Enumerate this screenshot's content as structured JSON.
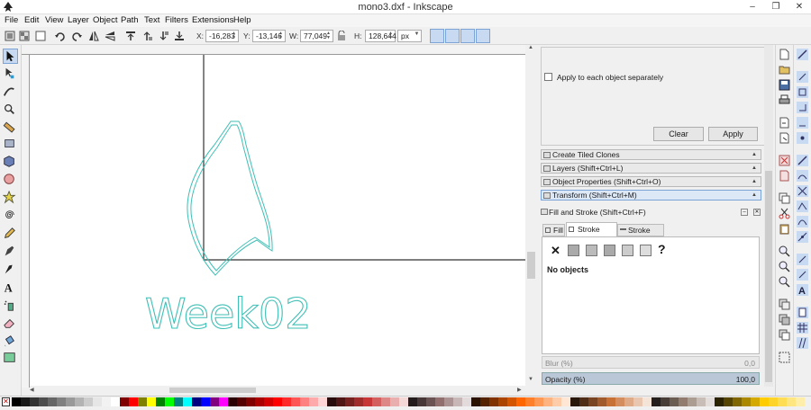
{
  "window": {
    "title": "mono3.dxf - Inkscape",
    "controls": [
      "–",
      "❐",
      "✕"
    ]
  },
  "menu": [
    "File",
    "Edit",
    "View",
    "Layer",
    "Object",
    "Path",
    "Text",
    "Filters",
    "Extensions",
    "Help"
  ],
  "toolbar": {
    "x_label": "X:",
    "x_value": "-16,283",
    "y_label": "Y:",
    "y_value": "-13,146",
    "w_label": "W:",
    "w_value": "77,049",
    "h_label": "H:",
    "h_value": "128,644",
    "unit": "px"
  },
  "canvas": {
    "text": "Week02",
    "stroke_color": "#3fbfb5"
  },
  "dock": {
    "checkbox_label": "Apply to each object separately",
    "clear_label": "Clear",
    "apply_label": "Apply",
    "panels": [
      "Create Tiled Clones",
      "Layers (Shift+Ctrl+L)",
      "Object Properties (Shift+Ctrl+O)",
      "Transform (Shift+Ctrl+M)"
    ],
    "fill_stroke_title": "Fill and Stroke (Shift+Ctrl+F)",
    "tabs": [
      "Fill",
      "Stroke paint",
      "Stroke style"
    ],
    "no_objects": "No objects",
    "blur_label": "Blur (%)",
    "blur_value": "0,0",
    "opacity_label": "Opacity (%)",
    "opacity_value": "100,0"
  },
  "palette_colors": [
    "#000000",
    "#1a1a1a",
    "#333333",
    "#4d4d4d",
    "#666666",
    "#808080",
    "#999999",
    "#b3b3b3",
    "#cccccc",
    "#e6e6e6",
    "#f2f2f2",
    "#ffffff",
    "#800000",
    "#ff0000",
    "#808000",
    "#ffff00",
    "#008000",
    "#00ff00",
    "#008080",
    "#00ffff",
    "#000080",
    "#0000ff",
    "#800080",
    "#ff00ff",
    "#2b0000",
    "#550000",
    "#800000",
    "#aa0000",
    "#d40000",
    "#ff0000",
    "#ff2a2a",
    "#ff5555",
    "#ff8080",
    "#ffaaaa",
    "#ffd5d5",
    "#280b0b",
    "#501616",
    "#782121",
    "#a02c2c",
    "#c83737",
    "#d35f5f",
    "#de8787",
    "#e9afaf",
    "#f4d7d7",
    "#241c1c",
    "#483737",
    "#6c5353",
    "#916f6f",
    "#ac9393",
    "#c8b7b7",
    "#e3dbdb",
    "#2b1100",
    "#552200",
    "#803300",
    "#aa4400",
    "#d45500",
    "#ff6600",
    "#ff7f2a",
    "#ff9955",
    "#ffb380",
    "#ffccaa",
    "#ffe6d5",
    "#28170b",
    "#502d16",
    "#784421",
    "#a05a2c",
    "#c87137",
    "#d38d5f",
    "#deaa87",
    "#e9c6af",
    "#f4e3d7",
    "#241f1c",
    "#483e37",
    "#6c5d53",
    "#917c6f",
    "#ac9d93",
    "#c8beb7",
    "#e3dedb",
    "#2b2200",
    "#554400",
    "#806600",
    "#aa8800",
    "#d4aa00",
    "#ffcc00",
    "#ffd42a",
    "#ffdd55",
    "#ffe680",
    "#ffeeaa",
    "#fff6d5"
  ]
}
